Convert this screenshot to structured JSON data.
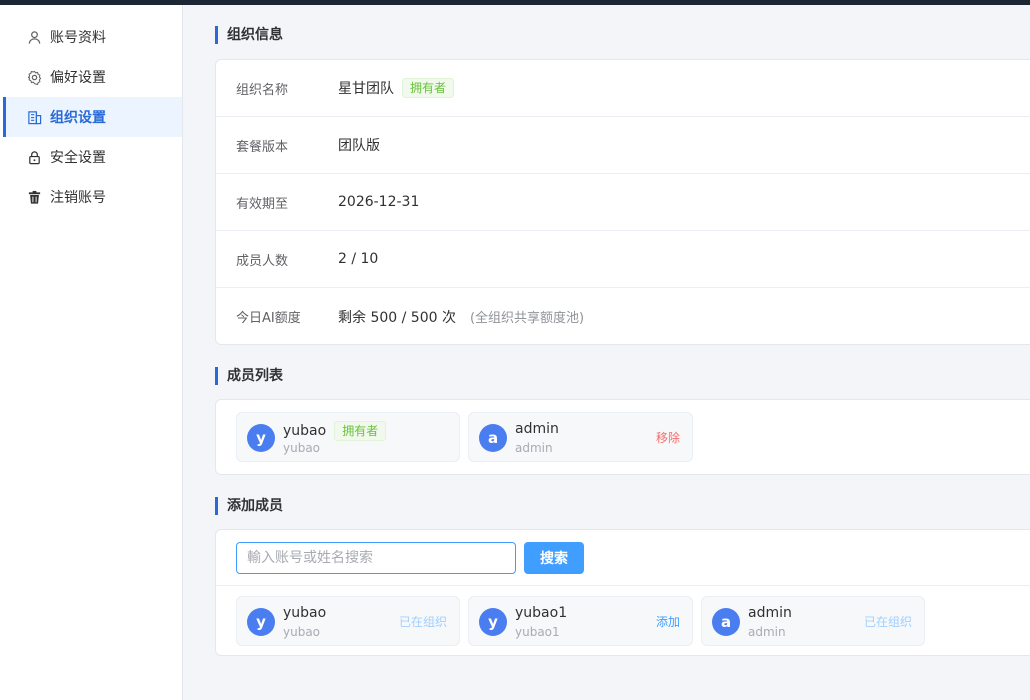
{
  "sidebar": {
    "items": [
      {
        "label": "账号资料",
        "icon": "user-icon"
      },
      {
        "label": "偏好设置",
        "icon": "gear-icon"
      },
      {
        "label": "组织设置",
        "icon": "building-icon",
        "active": true
      },
      {
        "label": "安全设置",
        "icon": "lock-icon"
      },
      {
        "label": "注销账号",
        "icon": "trash-icon"
      }
    ]
  },
  "org_info": {
    "title": "组织信息",
    "rows": [
      {
        "label": "组织名称",
        "value": "星甘团队",
        "tag": "拥有者"
      },
      {
        "label": "套餐版本",
        "value": "团队版"
      },
      {
        "label": "有效期至",
        "value": "2026-12-31"
      },
      {
        "label": "成员人数",
        "value": "2 / 10"
      },
      {
        "label": "今日AI额度",
        "value": "剩余 500 / 500 次",
        "note": "(全组织共享额度池)"
      }
    ]
  },
  "members": {
    "title": "成员列表",
    "list": [
      {
        "initial": "y",
        "name": "yubao",
        "username": "yubao",
        "tag": "拥有者"
      },
      {
        "initial": "a",
        "name": "admin",
        "username": "admin",
        "action": "移除"
      }
    ]
  },
  "add_member": {
    "title": "添加成员",
    "placeholder": "輸入账号或姓名搜索",
    "search_button": "搜索",
    "results": [
      {
        "initial": "y",
        "name": "yubao",
        "username": "yubao",
        "action": "已在组织"
      },
      {
        "initial": "y",
        "name": "yubao1",
        "username": "yubao1",
        "action": "添加"
      },
      {
        "initial": "a",
        "name": "admin",
        "username": "admin",
        "action": "已在组织"
      }
    ]
  },
  "colors": {
    "accent": "#2a6ad8",
    "primary_button": "#409eff",
    "owner_tag": "#67c23a",
    "remove": "#f56c6c",
    "avatar": "#4a7ef0"
  }
}
